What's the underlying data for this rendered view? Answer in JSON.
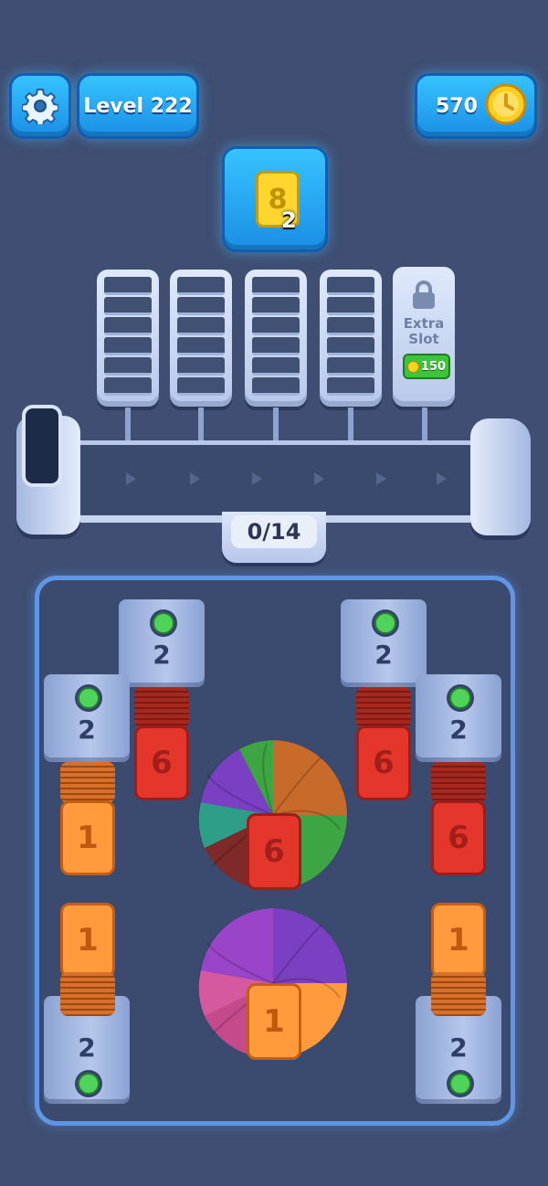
{
  "header": {
    "settings_icon": "gear-icon",
    "level_label": "Level 222",
    "coins_value": "570",
    "coin_icon": "coin-icon"
  },
  "target": {
    "card_number": "8",
    "card_count": "2",
    "card_color": "#ffd62e"
  },
  "slots": {
    "extra_slot_label_line1": "Extra",
    "extra_slot_label_line2": "Slot",
    "extra_slot_cost": "150",
    "lock_icon": "lock-icon"
  },
  "conveyor": {
    "progress": "0/14",
    "progress_value": 0,
    "progress_total": 14
  },
  "board": {
    "dispensers": [
      {
        "id": "top-left",
        "count": "2"
      },
      {
        "id": "left",
        "count": "2"
      },
      {
        "id": "top-right",
        "count": "2"
      },
      {
        "id": "right",
        "count": "2"
      },
      {
        "id": "bottom-left",
        "count": "2"
      },
      {
        "id": "bottom-right",
        "count": "2"
      }
    ],
    "stacks": [
      {
        "id": "stack-top-left",
        "number": "6",
        "color": "#e5362c"
      },
      {
        "id": "stack-left",
        "number": "1",
        "color": "#ff9a3d"
      },
      {
        "id": "stack-top-right",
        "number": "6",
        "color": "#e5362c"
      },
      {
        "id": "stack-right",
        "number": "6",
        "color": "#e5362c"
      },
      {
        "id": "stack-bottom-left",
        "number": "1",
        "color": "#ff9a3d"
      },
      {
        "id": "stack-bottom-right",
        "number": "1",
        "color": "#ff9a3d"
      }
    ],
    "fans": [
      {
        "id": "fan-top",
        "number": "6",
        "color": "#e5362c"
      },
      {
        "id": "fan-bottom",
        "number": "1",
        "color": "#ff9a3d"
      }
    ]
  }
}
